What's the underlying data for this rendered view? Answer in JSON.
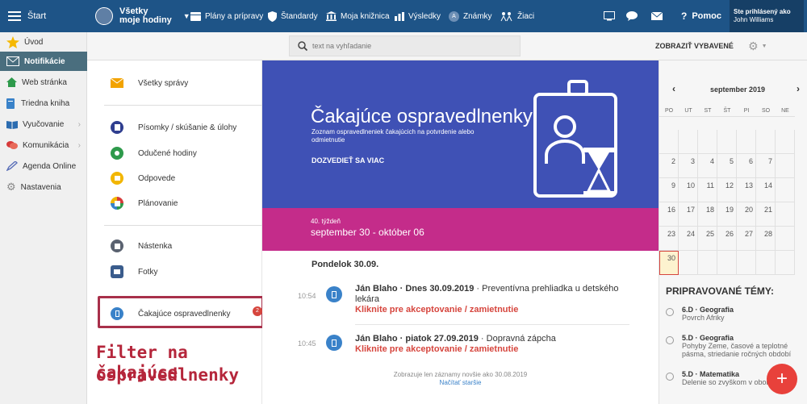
{
  "topbar": {
    "home": "Štart",
    "hours_line1": "Všetky",
    "hours_line2": "moje hodiny",
    "plans": "Plány a prípravy",
    "standards": "Štandardy",
    "library": "Moja knižnica",
    "results": "Výsledky",
    "grades": "Známky",
    "students": "Žiaci",
    "help": "Pomoc",
    "logged_line1": "Ste prihlásený ako",
    "logged_line2": "John Williams"
  },
  "search": {
    "placeholder": "text na vyhľadanie"
  },
  "toolbar": {
    "show_selected": "ZOBRAZIŤ VYBAVENÉ"
  },
  "sidebar": {
    "items": [
      {
        "label": "Úvod"
      },
      {
        "label": "Notifikácie"
      },
      {
        "label": "Web stránka"
      },
      {
        "label": "Triedna kniha"
      },
      {
        "label": "Vyučovanie"
      },
      {
        "label": "Komunikácia"
      },
      {
        "label": "Agenda Online"
      },
      {
        "label": "Nastavenia"
      }
    ]
  },
  "filters": {
    "all": "Všetky správy",
    "tests": "Písomky / skúšanie & úlohy",
    "taught": "Odučené hodiny",
    "answers": "Odpovede",
    "planning": "Plánovanie",
    "board": "Nástenka",
    "photos": "Fotky",
    "pending": "Čakajúce ospravedlnenky",
    "pending_count": "2"
  },
  "annotation": {
    "line1": "Filter na čakajúce",
    "line2": "ospravedlnenky"
  },
  "hero": {
    "title": "Čakajúce ospravedlnenky",
    "subtitle": "Zoznam ospravedlneniek čakajúcich na potvrdenie alebo odmietnutie",
    "cta": "DOZVEDIEŤ SA VIAC"
  },
  "week": {
    "label": "40. týždeň",
    "range": "september 30 - október 06"
  },
  "feed": {
    "day": "Pondelok 30.09.",
    "events": [
      {
        "time": "10:54",
        "author": "Ján Blaho",
        "date": "Dnes 30.09.2019",
        "text": "Preventívna prehliadka u detského lekára",
        "action": "Kliknite pre akceptovanie / zamietnutie"
      },
      {
        "time": "10:45",
        "author": "Ján Blaho",
        "date": "piatok 27.09.2019",
        "text": "Dopravná zápcha",
        "action": "Kliknite pre akceptovanie / zamietnutie"
      }
    ],
    "footer": "Zobrazuje len záznamy novšie ako 30.08.2019",
    "older": "Načítať staršie"
  },
  "calendar": {
    "month": "september 2019",
    "days": [
      "PO",
      "UT",
      "ST",
      "ŠT",
      "PI",
      "SO",
      "NE"
    ],
    "weeks": [
      [
        "",
        "",
        "",
        "",
        "",
        "",
        ""
      ],
      [
        "2",
        "3",
        "4",
        "5",
        "6",
        "7",
        ""
      ],
      [
        "9",
        "10",
        "11",
        "12",
        "13",
        "14",
        ""
      ],
      [
        "16",
        "17",
        "18",
        "19",
        "20",
        "21",
        ""
      ],
      [
        "23",
        "24",
        "25",
        "26",
        "27",
        "28",
        ""
      ],
      [
        "30",
        "",
        "",
        "",
        "",
        "",
        ""
      ]
    ]
  },
  "topics": {
    "title": "PRIPRAVOVANÉ TÉMY:",
    "items": [
      {
        "title": "6.D · Geografia",
        "desc": "Povrch Afriky"
      },
      {
        "title": "5.D · Geografia",
        "desc": "Pohyby Zeme, časové a teplotné pásma, striedanie ročných období"
      },
      {
        "title": "5.D · Matematika",
        "desc": "Delenie so zvyškom v obore"
      }
    ]
  },
  "fab": {
    "label": "+"
  },
  "colors": {
    "topbar": "#1e5487",
    "hero": "#3f51b5",
    "band": "#c42c8a",
    "accent": "#d6453d"
  }
}
